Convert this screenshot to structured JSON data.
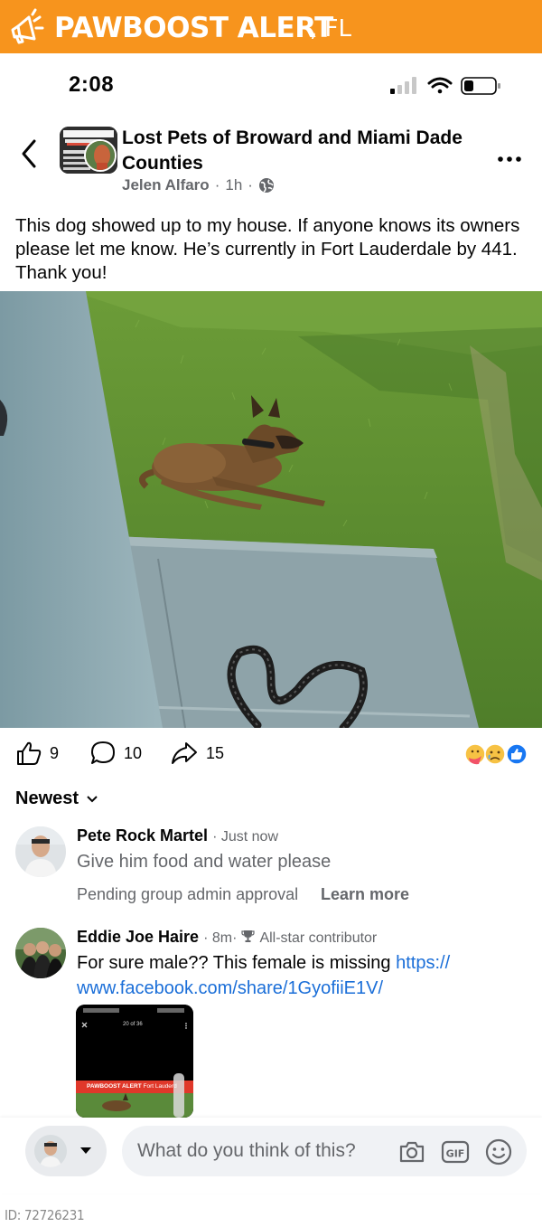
{
  "banner": {
    "title": "PAWBOOST ALERT",
    "state": ", FL",
    "color": "#f7941d"
  },
  "status_bar": {
    "time": "2:08",
    "icons": [
      "signal-icon",
      "wifi-icon",
      "battery-icon"
    ]
  },
  "post": {
    "group_name": "Lost Pets  of Broward and Miami Dade Counties",
    "author": "Jelen Alfaro",
    "time": "1h",
    "separator": "·",
    "audience_icon": "globe-icon",
    "text": "This dog showed up to my house. If anyone knows its owners please let me know. He’s currently in Fort Lauderdale by 441. Thank you!",
    "photo_alt": "Brown shepherd-type dog lying on grass next to a concrete walkway with a black leash"
  },
  "engagement": {
    "likes": "9",
    "comments": "10",
    "shares": "15",
    "reactions": [
      "care-reaction-icon",
      "sad-reaction-icon",
      "like-reaction-icon"
    ]
  },
  "sort_label": "Newest",
  "comments": [
    {
      "name": "Pete Rock Martel",
      "meta": "· Just now",
      "text": "Give him food and water please",
      "pending": "Pending group admin approval",
      "learn_more": "Learn more"
    },
    {
      "name": "Eddie Joe Haire",
      "meta": "· 8m·",
      "badge": "All-star contributor",
      "text_before": "For sure male?? This female is missing ",
      "link": "https://\nwww.facebook.com/share/1GyofiiE1V/",
      "thumb": {
        "counter": "20 of 36",
        "banner": "PAWBOOST ALERT",
        "banner_sub": "Fort Lauderd"
      }
    }
  ],
  "composer": {
    "placeholder": "What do you think of this?",
    "icons": [
      "camera-icon",
      "gif-icon",
      "emoji-icon"
    ]
  },
  "footer_id": "ID: 72726231"
}
